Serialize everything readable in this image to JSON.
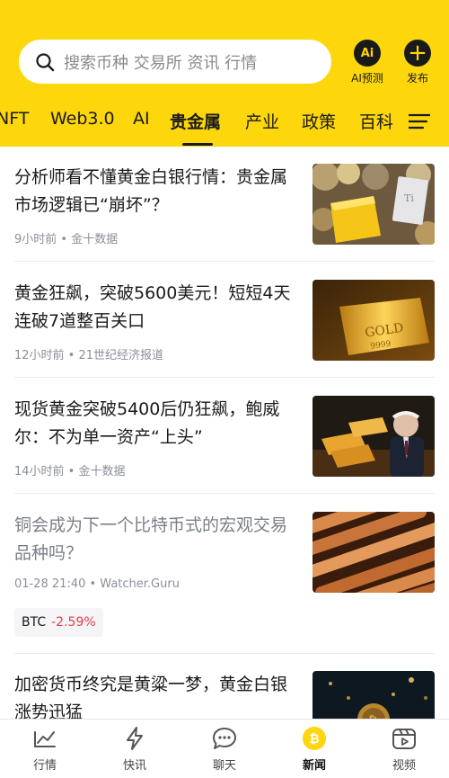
{
  "search": {
    "placeholder": "搜索币种 交易所 资讯 行情"
  },
  "top_actions": [
    {
      "icon": "ai-predict-icon",
      "glyph": "Ai",
      "label": "AI预测"
    },
    {
      "icon": "plus-icon",
      "glyph": "+",
      "label": "发布"
    }
  ],
  "tabs": [
    {
      "label": "NFT"
    },
    {
      "label": "Web3.0"
    },
    {
      "label": "AI"
    },
    {
      "label": "贵金属",
      "active": true
    },
    {
      "label": "产业"
    },
    {
      "label": "政策"
    },
    {
      "label": "百科"
    }
  ],
  "articles": [
    {
      "title": "分析师看不懂黄金白银行情：贵金属市场逻辑已“崩坏”？",
      "meta": "9小时前 • 金十数据"
    },
    {
      "title": "黄金狂飙，突破5600美元！短短4天连破7道整百关口",
      "meta": "12小时前 • 21世纪经济报道"
    },
    {
      "title": "现货黄金突破5400后仍狂飙，鲍威尔：不为单一资产“上头”",
      "meta": "14小时前 • 金十数据"
    },
    {
      "title": "铜会成为下一个比特币式的宏观交易品种吗？",
      "meta": "01-28 21:40 • Watcher.Guru",
      "read": true,
      "coin": {
        "symbol": "BTC",
        "change": "-2.59%"
      }
    },
    {
      "title": "加密货币终究是黄粱一梦，黄金白银涨势迅猛",
      "meta": ""
    }
  ],
  "bottom_nav": [
    {
      "icon": "chart-icon",
      "label": "行情"
    },
    {
      "icon": "lightning-icon",
      "label": "快讯"
    },
    {
      "icon": "chat-icon",
      "label": "聊天"
    },
    {
      "icon": "news-coin-icon",
      "label": "新闻",
      "active": true
    },
    {
      "icon": "video-icon",
      "label": "视频"
    }
  ],
  "colors": {
    "brand_yellow": "#fdd60b",
    "text": "#1a1a1a",
    "negative": "#e83a4a"
  }
}
